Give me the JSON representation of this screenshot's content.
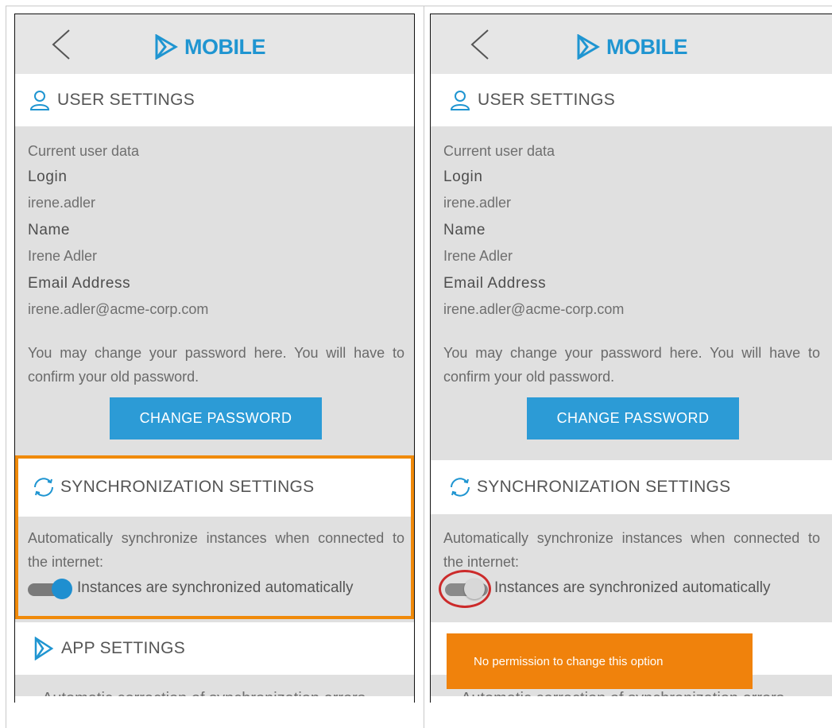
{
  "brand": {
    "name": "MOBILE",
    "color": "#1f95d1"
  },
  "left": {
    "user_settings": {
      "title": "USER SETTINGS",
      "intro": "Current user data",
      "login_label": "Login",
      "login_value": "irene.adler",
      "name_label": "Name",
      "name_value": "Irene Adler",
      "email_label": "Email Address",
      "email_value": "irene.adler@acme-corp.com",
      "password_hint": "You may change your password here. You will have to confirm your old password.",
      "change_password": "CHANGE PASSWORD"
    },
    "sync_settings": {
      "title": "SYNCHRONIZATION SETTINGS",
      "description": "Automatically synchronize instances when connected to the internet:",
      "toggle_label": "Instances are synchronized automatically",
      "toggle_on": true
    },
    "app_settings": {
      "title": "APP SETTINGS",
      "cut_text": "Automatic correction of synchronization errors"
    }
  },
  "right": {
    "user_settings": {
      "title": "USER SETTINGS",
      "intro": "Current user data",
      "login_label": "Login",
      "login_value": "irene.adler",
      "name_label": "Name",
      "name_value": "Irene Adler",
      "email_label": "Email Address",
      "email_value": "irene.adler@acme-corp.com",
      "password_hint": "You may change your password here. You will have to confirm your old password.",
      "change_password": "CHANGE PASSWORD"
    },
    "sync_settings": {
      "title": "SYNCHRONIZATION SETTINGS",
      "description": "Automatically synchronize instances when connected to the internet:",
      "toggle_label": "Instances are synchronized automatically",
      "toggle_on": false
    },
    "toast": {
      "message": "No permission to change this option"
    },
    "cut_text": "Automatic correction of synchronization errors"
  },
  "colors": {
    "accent": "#2c9bd6",
    "highlight": "#f08a0b",
    "toast": "#f0820c",
    "ring": "#cc2b2b"
  }
}
